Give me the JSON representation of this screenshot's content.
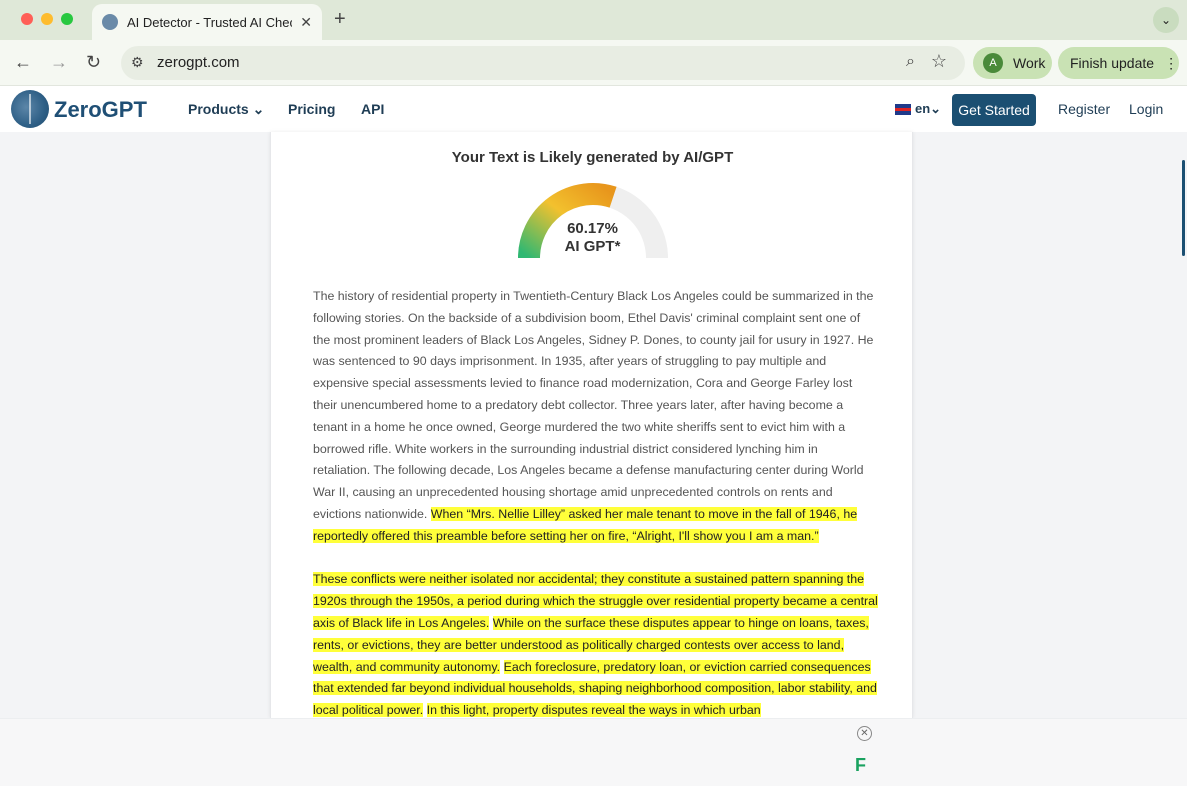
{
  "browser": {
    "tab_title": "AI Detector - Trusted AI Chec",
    "tab_close": "✕",
    "new_tab": "+",
    "tab_menu": "⌄",
    "url": "zerogpt.com",
    "back": "←",
    "forward": "→",
    "reload": "↻",
    "profile_initial": "A",
    "profile_label": "Work",
    "update_label": "Finish update",
    "update_menu": "⋮"
  },
  "site": {
    "logo_text": "ZeroGPT",
    "nav": {
      "products": "Products ⌄",
      "pricing": "Pricing",
      "api": "API"
    },
    "language": "en⌄",
    "get_started": "Get Started",
    "register": "Register",
    "login": "Login"
  },
  "result": {
    "title": "Your Text is Likely generated by AI/GPT",
    "percent_text": "60.17%",
    "percent_value": 60.17,
    "label": "AI GPT*"
  },
  "analyzed_text": {
    "para1_plain": "The history of residential property in Twentieth-Century Black Los Angeles could be summarized in the following stories. On the backside of a subdivision boom, Ethel Davis' criminal complaint sent one of the most prominent leaders of Black Los Angeles, Sidney P. Dones, to county jail for usury in 1927. He was sentenced to 90 days imprisonment. In 1935, after years of struggling to pay multiple and expensive special assessments levied to finance road modernization, Cora and George Farley lost their unencumbered home to a predatory debt collector. Three years later, after having become a tenant in a home he once owned, George murdered the two white sheriffs sent to evict him with a borrowed rifle. White workers in the surrounding industrial district considered lynching him in retaliation. The following decade, Los Angeles became a defense manufacturing center during World War II, causing an unprecedented housing shortage amid unprecedented controls on rents and evictions nationwide.",
    "para1_highlight": "When “Mrs. Nellie Lilley” asked her male tenant to move in the fall of 1946, he reportedly offered this preamble before setting her on fire, “Alright, I'll show you I am a man.”",
    "para2_h1": "These conflicts were neither isolated nor accidental; they constitute a sustained pattern spanning the 1920s through the 1950s, a period during which the struggle over residential property became a central axis of Black life in Los Angeles.",
    "para2_h2": "While on the surface these disputes appear to hinge on loans, taxes, rents, or evictions, they are better understood as politically charged contests over access to land, wealth, and community autonomy.",
    "para2_h3": "Each foreclosure, predatory loan, or eviction carried consequences that extended far beyond individual households, shaping neighborhood composition, labor stability, and local political power.",
    "para2_h4": "In this light, property disputes reveal the ways in which urban"
  },
  "ad": {
    "close": "✕",
    "logo": "F"
  },
  "colors": {
    "brand": "#1b4f72",
    "highlight": "#ffff3a",
    "gauge_green": "#2fb872",
    "gauge_yellow": "#f2c12e",
    "gauge_orange": "#e8961c",
    "gauge_track": "#efefef"
  },
  "icons": {
    "site_info": "tune-icon",
    "zoom": "magnifier-icon",
    "bookmark": "star-icon",
    "ad_close": "close-icon"
  }
}
